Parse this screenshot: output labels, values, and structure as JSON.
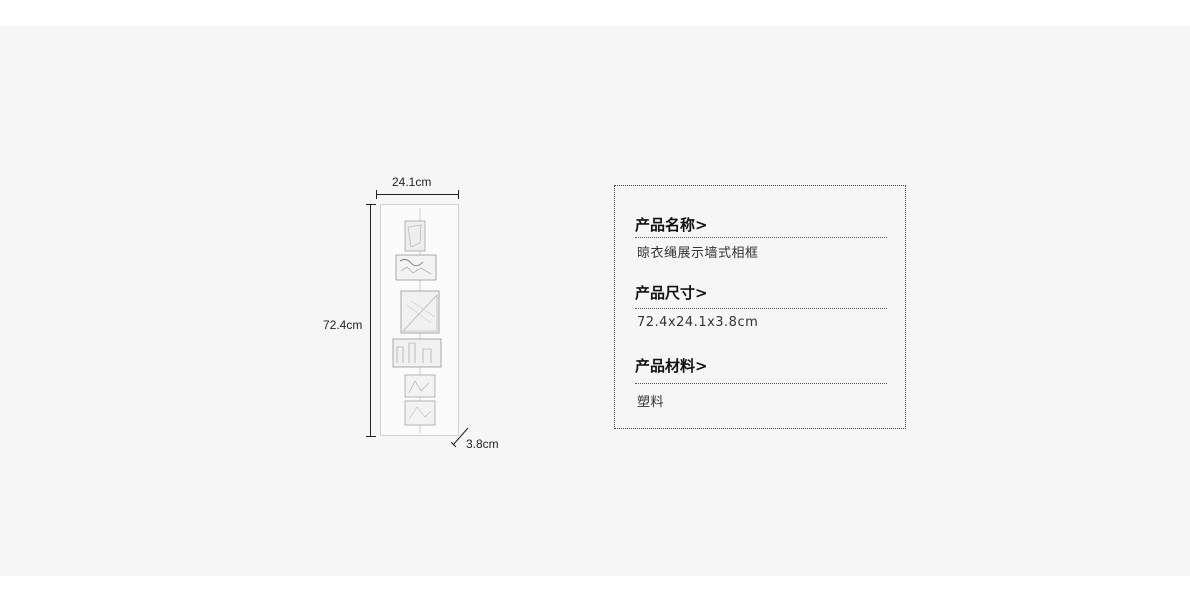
{
  "dimensions": {
    "width_label": "24.1cm",
    "height_label": "72.4cm",
    "depth_label": "3.8cm"
  },
  "specs": [
    {
      "title": "产品名称>",
      "value": "晾衣绳展示墙式相框"
    },
    {
      "title": "产品尺寸>",
      "value": "72.4x24.1x3.8cm"
    },
    {
      "title": "产品材料>",
      "value": "塑料"
    }
  ],
  "colors": {
    "band": "#f6f6f6",
    "text": "#222222",
    "border": "#444444"
  }
}
